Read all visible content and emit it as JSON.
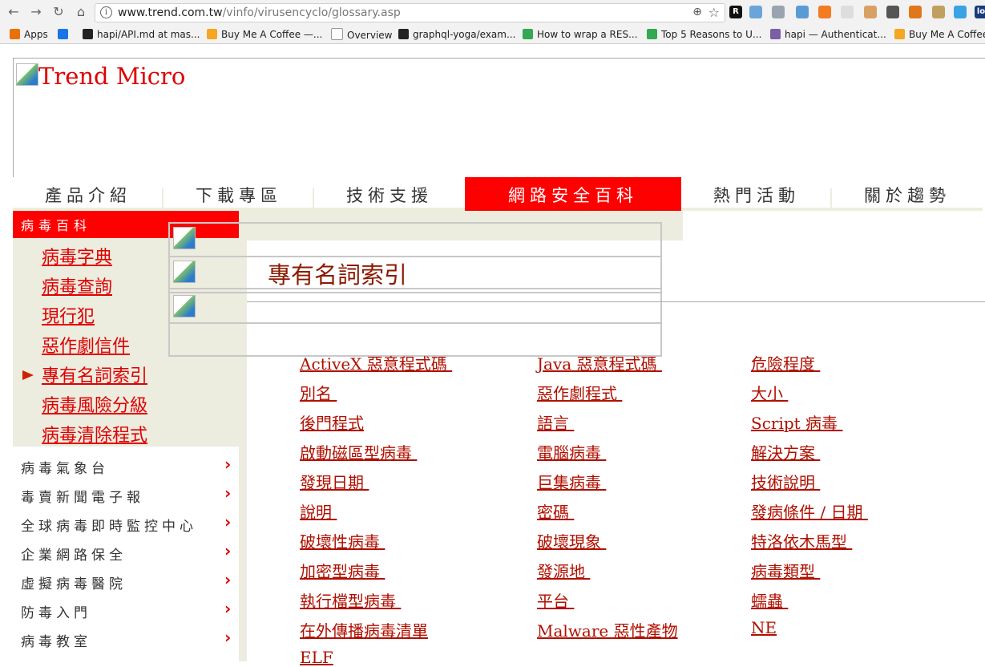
{
  "browser": {
    "url_host": "www.trend.com.tw",
    "url_path": "/vinfo/virusencyclo/glossary.asp",
    "bookmarks": [
      {
        "label": "Apps",
        "color": "#e8710a"
      },
      {
        "label": "",
        "color": "#1a73e8"
      },
      {
        "label": "hapi/API.md at mas...",
        "color": "#222222"
      },
      {
        "label": "Buy Me A Coffee —...",
        "color": "#f5a623"
      },
      {
        "label": "Overview",
        "color": "#ffffff"
      },
      {
        "label": "graphql-yoga/exam...",
        "color": "#222222"
      },
      {
        "label": "How to wrap a RES...",
        "color": "#34a853"
      },
      {
        "label": "Top 5 Reasons to U...",
        "color": "#34a853"
      },
      {
        "label": "hapi — Authenticat...",
        "color": "#7b5ea7"
      },
      {
        "label": "Buy Me A Coffee",
        "color": "#f5a623"
      }
    ],
    "extensions": [
      {
        "label": "R",
        "color": "#111111"
      },
      {
        "label": "",
        "color": "#6ba4d8"
      },
      {
        "label": "",
        "color": "#9aa4b0"
      },
      {
        "label": "",
        "color": "#5b9bd5"
      },
      {
        "label": "",
        "color": "#f47b20"
      },
      {
        "label": "",
        "color": "#dddddd"
      },
      {
        "label": "",
        "color": "#d9a066"
      },
      {
        "label": "",
        "color": "#555555"
      },
      {
        "label": "",
        "color": "#e2761b"
      },
      {
        "label": "",
        "color": "#c0a060"
      },
      {
        "label": "",
        "color": "#3aa3e3"
      },
      {
        "label": "lo",
        "color": "#1a3a7a"
      }
    ]
  },
  "page": {
    "logo_alt": "Trend Micro",
    "top_nav": [
      "產品介紹",
      "下載專區",
      "技術支援",
      "網路安全百科",
      "熱門活動",
      "關於趨勢"
    ],
    "active_tab_index": 3,
    "sidebar_header": "病毒百科",
    "sidebar_links": [
      "病毒字典",
      "病毒查詢",
      "現行犯",
      "惡作劇信件",
      "專有名詞索引",
      "病毒風險分級",
      "病毒清除程式"
    ],
    "current_link_index": 4,
    "sidebar_menu": [
      "病毒氣象台",
      "毒賣新聞電子報",
      "全球病毒即時監控中心",
      "企業網路保全",
      "虛擬病毒醫院",
      "防毒入門",
      "病毒教室"
    ],
    "title": "專有名詞索引",
    "glossary": {
      "col1": [
        "ActiveX 惡意程式碼 ",
        "別名 ",
        "後門程式",
        "啟動磁區型病毒 ",
        "發現日期 ",
        "說明 ",
        "破壞性病毒 ",
        "加密型病毒 ",
        "執行檔型病毒 ",
        "在外傳播病毒清單",
        "ELF"
      ],
      "col2": [
        "Java 惡意程式碼 ",
        "惡作劇程式 ",
        "語言 ",
        "電腦病毒 ",
        "巨集病毒 ",
        "密碼 ",
        "破壞現象 ",
        "發源地 ",
        "平台 ",
        "Malware 惡性產物"
      ],
      "col3": [
        "危險程度 ",
        "大小 ",
        "Script 病毒 ",
        "解決方案 ",
        "技術說明 ",
        "發病條件 / 日期 ",
        "特洛依木馬型 ",
        "病毒類型 ",
        "蠕蟲 ",
        "NE"
      ]
    }
  },
  "colors": {
    "accent_red": "#ff0000",
    "link_red": "#b01000",
    "panel_beige": "#ececdf"
  }
}
